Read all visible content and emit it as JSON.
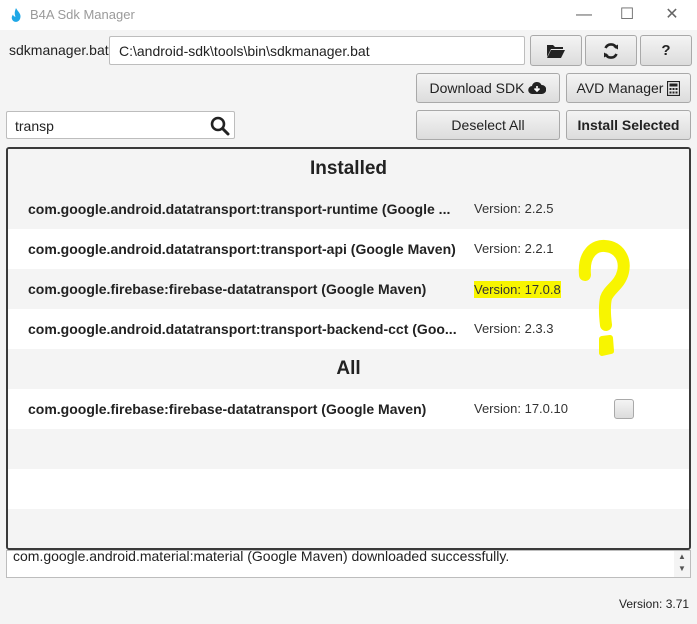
{
  "window": {
    "title": "B4A Sdk Manager",
    "minimize_label": "—",
    "maximize_label": "☐",
    "close_label": "✕"
  },
  "sdk": {
    "label": "sdkmanager.bat:",
    "path": "C:\\android-sdk\\tools\\bin\\sdkmanager.bat"
  },
  "toolbar": {
    "download_label": "Download SDK",
    "avd_label": "AVD Manager",
    "deselect_label": "Deselect All",
    "install_label": "Install Selected",
    "help_label": "?"
  },
  "search": {
    "value": "transp"
  },
  "installed": {
    "heading": "Installed",
    "items": [
      {
        "name": "com.google.android.datatransport:transport-runtime (Google ...",
        "version": "Version: 2.2.5"
      },
      {
        "name": "com.google.android.datatransport:transport-api (Google Maven)",
        "version": "Version: 2.2.1"
      },
      {
        "name": "com.google.firebase:firebase-datatransport (Google Maven)",
        "version": "Version: 17.0.8"
      },
      {
        "name": "com.google.android.datatransport:transport-backend-cct (Goo...",
        "version": "Version: 2.3.3"
      }
    ]
  },
  "all": {
    "heading": "All",
    "items": [
      {
        "name": "com.google.firebase:firebase-datatransport (Google Maven)",
        "version": "Version: 17.0.10",
        "checked": false
      }
    ]
  },
  "annotation": {
    "symbol": "?",
    "color": "#f8f500"
  },
  "log": {
    "text": "com.google.android.material:material (Google Maven) downloaded successfully."
  },
  "footer": {
    "version": "Version: 3.71"
  },
  "colors": {
    "highlight": "#f8f500",
    "app_icon": "#1ea7e6"
  }
}
